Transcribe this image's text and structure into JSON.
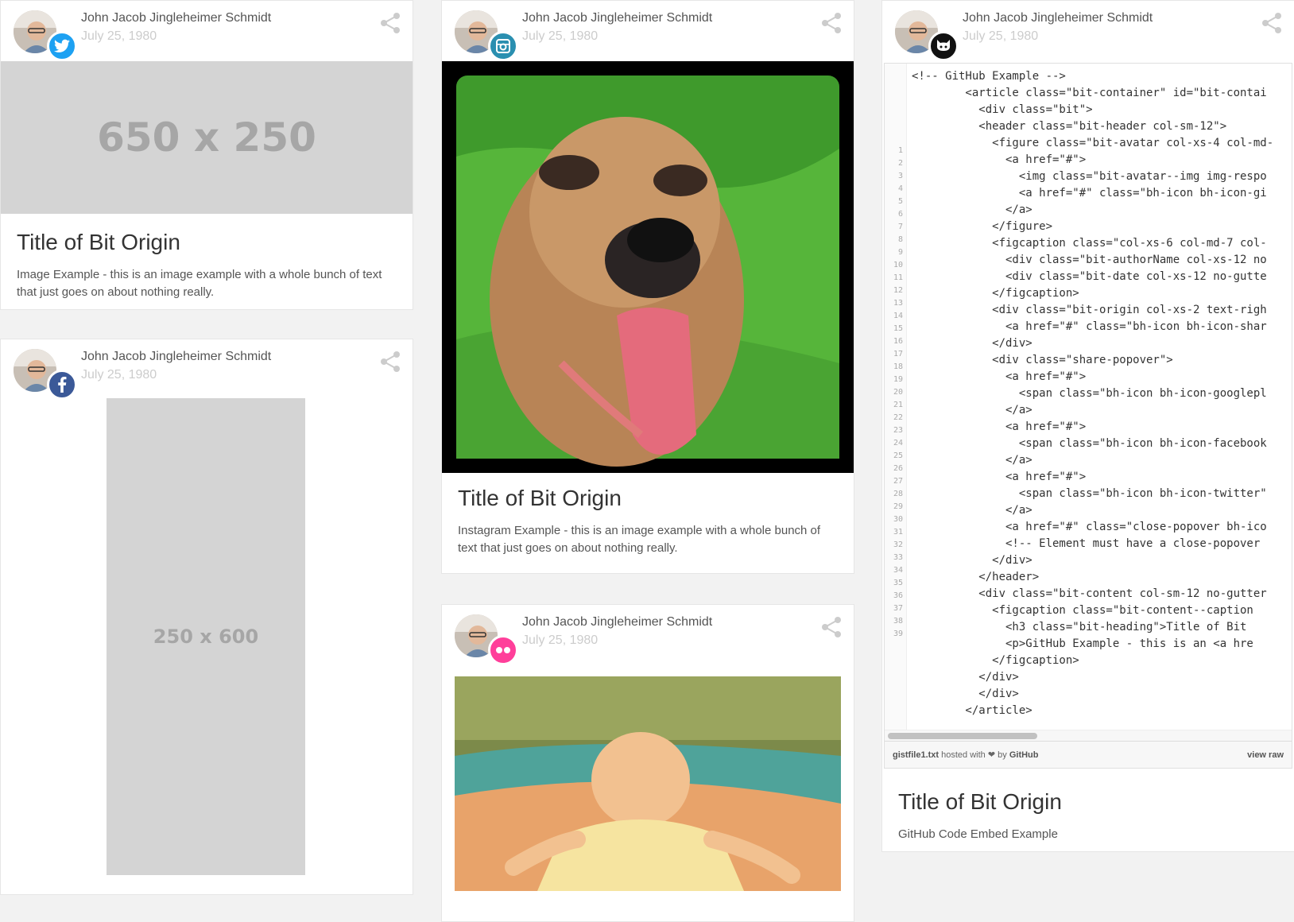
{
  "cards": {
    "twitter": {
      "author": "John Jacob Jingleheimer Schmidt",
      "date": "July 25, 1980",
      "placeholder": "650 x 250",
      "title": "Title of Bit Origin",
      "description": "Image Example - this is an image example with a whole bunch of text that just goes on about nothing really.",
      "network_icon": "twitter-icon",
      "network_color": "#1da1f2"
    },
    "facebook": {
      "author": "John Jacob Jingleheimer Schmidt",
      "date": "July 25, 1980",
      "placeholder": "250 x 600",
      "network_icon": "facebook-icon",
      "network_color": "#3b5998"
    },
    "instagram": {
      "author": "John Jacob Jingleheimer Schmidt",
      "date": "July 25, 1980",
      "title": "Title of Bit Origin",
      "description": "Instagram Example - this is an image example with a whole bunch of text that just goes on about nothing really.",
      "network_icon": "instagram-icon",
      "network_color": "#2a8fb0"
    },
    "flickr": {
      "author": "John Jacob Jingleheimer Schmidt",
      "date": "July 25, 1980",
      "network_icon": "flickr-icon",
      "network_color": "#ff3f9a"
    },
    "github": {
      "author": "John Jacob Jingleheimer Schmidt",
      "date": "July 25, 1980",
      "title": "Title of Bit Origin",
      "description": "GitHub Code Embed Example",
      "network_icon": "github-icon",
      "network_color": "#111111",
      "gist_filename": "gistfile1.txt",
      "gist_hosted": "hosted with",
      "gist_by": "by",
      "gist_host": "GitHub",
      "gist_view_raw": "view raw",
      "line_numbers": "1\n2\n3\n4\n5\n6\n7\n8\n9\n10\n11\n12\n13\n14\n15\n16\n17\n18\n19\n20\n21\n22\n23\n24\n25\n26\n27\n28\n29\n30\n31\n32\n33\n34\n35\n36\n37\n38\n39",
      "code": "<!-- GitHub Example -->\n        <article class=\"bit-container\" id=\"bit-contai\n          <div class=\"bit\">\n          <header class=\"bit-header col-sm-12\">\n            <figure class=\"bit-avatar col-xs-4 col-md-\n              <a href=\"#\">\n                <img class=\"bit-avatar--img img-respo\n                <a href=\"#\" class=\"bh-icon bh-icon-gi\n              </a>\n            </figure>\n            <figcaption class=\"col-xs-6 col-md-7 col-\n              <div class=\"bit-authorName col-xs-12 no\n              <div class=\"bit-date col-xs-12 no-gutte\n            </figcaption>\n            <div class=\"bit-origin col-xs-2 text-righ\n              <a href=\"#\" class=\"bh-icon bh-icon-shar\n            </div>\n            <div class=\"share-popover\">\n              <a href=\"#\">\n                <span class=\"bh-icon bh-icon-googlepl\n              </a>\n              <a href=\"#\">\n                <span class=\"bh-icon bh-icon-facebook\n              </a>\n              <a href=\"#\">\n                <span class=\"bh-icon bh-icon-twitter\"\n              </a>\n              <a href=\"#\" class=\"close-popover bh-ico\n              <!-- Element must have a close-popover \n            </div>\n          </header>\n          <div class=\"bit-content col-sm-12 no-gutter\n            <figcaption class=\"bit-content--caption\n              <h3 class=\"bit-heading\">Title of Bit \n              <p>GitHub Example - this is an <a hre\n            </figcaption>\n          </div>\n          </div>\n        </article>"
    }
  }
}
